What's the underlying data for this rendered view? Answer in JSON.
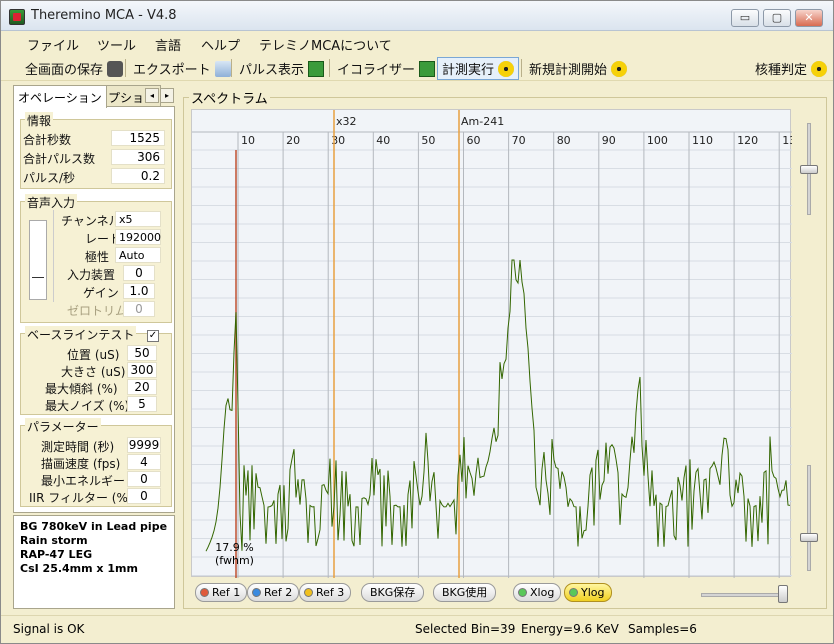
{
  "window": {
    "title": "Theremino MCA - V4.8",
    "minimize": "▭",
    "maximize": "▢",
    "close": "✕"
  },
  "menu": [
    "ファイル",
    "ツール",
    "言語",
    "ヘルプ",
    "テレミノMCAについて"
  ],
  "toolbar": {
    "save_all": "全画面の保存",
    "export": "エクスポート",
    "pulse_view": "パルス表示",
    "equalizer": "イコライザー",
    "run": "計測実行",
    "new_measure": "新規計測開始",
    "nuclide": "核種判定"
  },
  "tabs": {
    "operation": "オペレーション",
    "options": "オプション",
    "prev": "◂",
    "next": "▸"
  },
  "info": {
    "title": "情報",
    "total_sec_label": "合計秒数",
    "total_sec": "1525",
    "total_pulses_label": "合計パルス数",
    "total_pulses": "306",
    "pulse_rate_label": "パルス/秒",
    "pulse_rate": "0.2"
  },
  "audio": {
    "title": "音声入力",
    "channel_label": "チャンネル",
    "channel": "x5",
    "rate_label": "レート",
    "rate": "192000",
    "polarity_label": "極性",
    "polarity": "Auto",
    "input_label": "入力装置",
    "input": "0",
    "gain_label": "ゲイン",
    "gain": "1.0",
    "zero_label": "ゼロトリム",
    "zero": "0"
  },
  "baseline": {
    "title": "ベースラインテスト",
    "checked": "✓",
    "pos_label": "位置 (uS)",
    "pos": "50",
    "size_label": "大きさ (uS)",
    "size": "300",
    "slope_label": "最大傾斜 (%)",
    "slope": "20",
    "noise_label": "最大ノイズ (%)",
    "noise": "5"
  },
  "params": {
    "title": "パラメーター",
    "time_label": "測定時間 (秒)",
    "time": "9999",
    "speed_label": "描画速度 (fps)",
    "speed": "4",
    "min_energy_label": "最小エネルギー",
    "min_energy": "0",
    "iir_label": "IIR フィルター (%)",
    "iir": "0"
  },
  "notes": [
    "BG 780keV in Lead pipe",
    "Rain storm",
    "RAP-47 LEG",
    "CsI 25.4mm x 1mm"
  ],
  "spectrum": {
    "title": "スペクトラム",
    "marker1": "x32",
    "marker2": "Am-241",
    "fwhm_value": "17.9 %",
    "fwhm_label": "(fwhm)",
    "ticks": [
      "10",
      "20",
      "30",
      "40",
      "50",
      "60",
      "70",
      "80",
      "90",
      "100",
      "110",
      "120",
      "13"
    ],
    "line_color": "#336600",
    "marker_color": "#e8a040",
    "ref_color": "#c05030"
  },
  "chart_buttons": {
    "ref1": "Ref 1",
    "ref2": "Ref 2",
    "ref3": "Ref 3",
    "bkg_save": "BKG保存",
    "bkg_use": "BKG使用",
    "xlog": "Xlog",
    "ylog": "Ylog"
  },
  "status": {
    "signal": "Signal is OK",
    "bin": "Selected Bin=39",
    "energy": "Energy=9.6 KeV",
    "samples": "Samples=6"
  }
}
